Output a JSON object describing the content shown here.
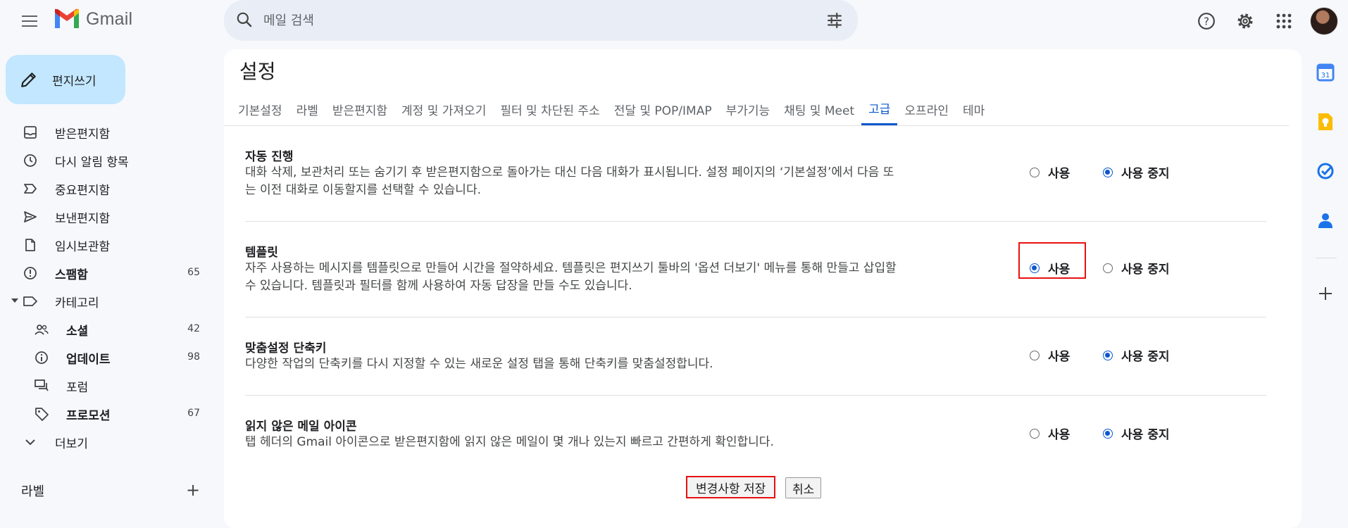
{
  "app": {
    "name": "Gmail"
  },
  "search": {
    "placeholder": "메일 검색"
  },
  "compose": {
    "label": "편지쓰기"
  },
  "sidebar": {
    "items": [
      {
        "label": "받은편지함",
        "count": ""
      },
      {
        "label": "다시 알림 항목",
        "count": ""
      },
      {
        "label": "중요편지함",
        "count": ""
      },
      {
        "label": "보낸편지함",
        "count": ""
      },
      {
        "label": "임시보관함",
        "count": ""
      },
      {
        "label": "스팸함",
        "count": "65"
      },
      {
        "label": "카테고리",
        "count": ""
      },
      {
        "label": "소셜",
        "count": "42"
      },
      {
        "label": "업데이트",
        "count": "98"
      },
      {
        "label": "포럼",
        "count": ""
      },
      {
        "label": "프로모션",
        "count": "67"
      },
      {
        "label": "더보기",
        "count": ""
      }
    ],
    "labels_heading": "라벨"
  },
  "settings": {
    "title": "설정",
    "tabs": [
      "기본설정",
      "라벨",
      "받은편지함",
      "계정 및 가져오기",
      "필터 및 차단된 주소",
      "전달 및 POP/IMAP",
      "부가기능",
      "채팅 및 Meet",
      "고급",
      "오프라인",
      "테마"
    ],
    "active_tab": "고급",
    "rows": [
      {
        "title": "자동 진행",
        "desc_line1": "대화 삭제, 보관처리 또는 숨기기 후 받은편지함으로 돌아가는 대신 다음 대화가 표시됩니다. 설정 페이지의 ‘기본설정’에서 다음 또",
        "desc_line2": "는 이전 대화로 이동할지를 선택할 수 있습니다.",
        "selected": "disable"
      },
      {
        "title": "템플릿",
        "desc_line1": "자주 사용하는 메시지를 템플릿으로 만들어 시간을 절약하세요. 템플릿은 편지쓰기 툴바의 '옵션 더보기' 메뉴를 통해 만들고 삽입할",
        "desc_line2": "수 있습니다. 템플릿과 필터를 함께 사용하여 자동 답장을 만들 수도 있습니다.",
        "selected": "enable"
      },
      {
        "title": "맞춤설정 단축키",
        "desc_line1": "다양한 작업의 단축키를 다시 지정할 수 있는 새로운 설정 탭을 통해 단축키를 맞춤설정합니다.",
        "desc_line2": "",
        "selected": "disable"
      },
      {
        "title": "읽지 않은 메일 아이콘",
        "desc_line1": "탭 헤더의 Gmail 아이콘으로 받은편지함에 읽지 않은 메일이 몇 개나 있는지 빠르고 간편하게 확인합니다.",
        "desc_line2": "",
        "selected": "disable"
      }
    ],
    "enable_label": "사용",
    "disable_label": "사용 중지",
    "save_label": "변경사항 저장",
    "cancel_label": "취소"
  },
  "colors": {
    "accent": "#0b57d0",
    "highlight": "#e81111",
    "compose_bg": "#c2e7ff"
  }
}
